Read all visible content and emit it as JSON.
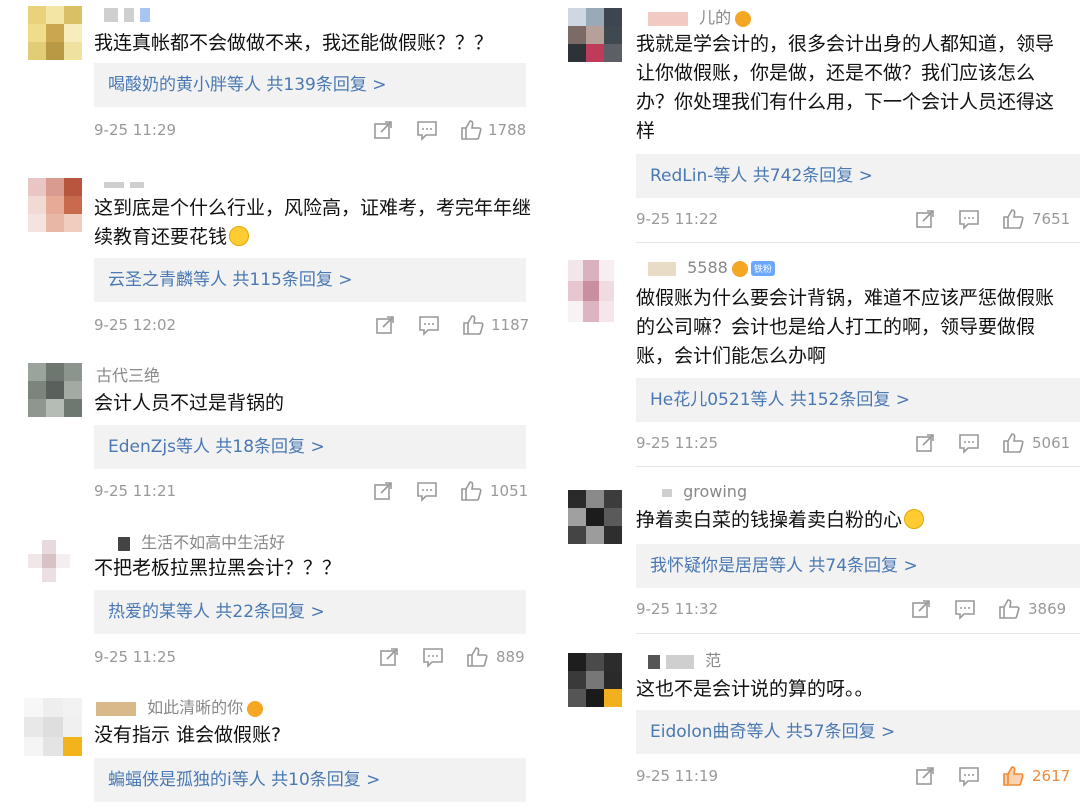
{
  "left": [
    {
      "username": "",
      "text": "我连真帐都不会做做不来，我还能做假账？？？",
      "reply_names": "喝酸奶的黄小胖等人",
      "reply_count": "共139条回复 >",
      "time": "9-25 11:29",
      "likes": "1788"
    },
    {
      "username": "",
      "text": "这到底是个什么行业，风险高，证难考，考完年年继续教育还要花钱",
      "reply_names": "云圣之青麟等人",
      "reply_count": "共115条回复 >",
      "time": "9-25 12:02",
      "likes": "1187"
    },
    {
      "username": "古代三绝",
      "text": "会计人员不过是背锅的",
      "reply_names": "EdenZjs等人",
      "reply_count": "共18条回复 >",
      "time": "9-25 11:21",
      "likes": "1051"
    },
    {
      "username": "生活不如高中生活好",
      "text": "不把老板拉黑拉黑会计？？？",
      "reply_names": "热爱的某等人",
      "reply_count": "共22条回复 >",
      "time": "9-25 11:25",
      "likes": "889"
    },
    {
      "username": "如此清晰的你",
      "text": "没有指示 谁会做假账?",
      "reply_names": "蝙蝠侠是孤独的i等人",
      "reply_count": "共10条回复 >",
      "time": "",
      "likes": ""
    }
  ],
  "right": [
    {
      "username": "儿的",
      "text": "我就是学会计的，很多会计出身的人都知道，领导让你做假账，你是做，还是不做？我们应该怎么办？你处理我们有什么用，下一个会计人员还得这样",
      "reply_names": "RedLin-等人",
      "reply_count": "共742条回复 >",
      "time": "9-25 11:22",
      "likes": "7651"
    },
    {
      "username": "5588",
      "tag": "铁粉",
      "text": "做假账为什么要会计背锅，难道不应该严惩做假账的公司嘛？会计也是给人打工的啊，领导要做假账，会计们能怎么办啊",
      "reply_names": "He花儿0521等人",
      "reply_count": "共152条回复 >",
      "time": "9-25 11:25",
      "likes": "5061"
    },
    {
      "username": "growing",
      "text": "挣着卖白菜的钱操着卖白粉的心",
      "reply_names": "我怀疑你是居居等人",
      "reply_count": "共74条回复 >",
      "time": "9-25 11:32",
      "likes": "3869"
    },
    {
      "username": "范",
      "text": "这也不是会计说的算的呀。。",
      "reply_names": "Eidolon曲奇等人",
      "reply_count": "共57条回复 >",
      "time": "9-25 11:19",
      "likes": "2617"
    }
  ],
  "colors": {
    "link": "#4a78b3",
    "like_active": "#f08a36",
    "meta": "#999999",
    "reply_bg": "#f2f2f2"
  },
  "icons": [
    "share-icon",
    "comment-icon",
    "like-icon"
  ]
}
